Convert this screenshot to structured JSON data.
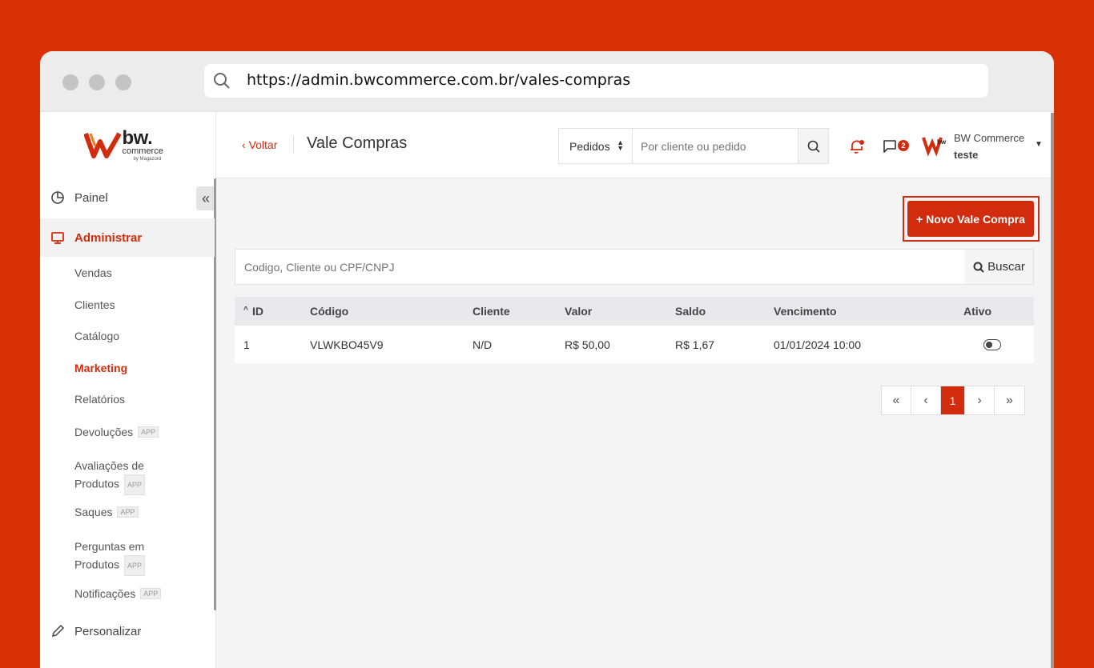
{
  "browser": {
    "url": "https://admin.bwcommerce.com.br/vales-compras"
  },
  "brand": {
    "name": "bw.",
    "sub": "commerce",
    "by": "by Magazord"
  },
  "sidebar": {
    "items": [
      {
        "label": "Painel"
      },
      {
        "label": "Administrar"
      },
      {
        "label": "Vendas"
      },
      {
        "label": "Clientes"
      },
      {
        "label": "Catálogo"
      },
      {
        "label": "Marketing"
      },
      {
        "label": "Relatórios"
      },
      {
        "label": "Devoluções",
        "badge": "APP"
      },
      {
        "label": "Avaliações de",
        "label2": "Produtos",
        "badge": "APP"
      },
      {
        "label": "Saques",
        "badge": "APP"
      },
      {
        "label": "Perguntas em",
        "label2": "Produtos",
        "badge": "APP"
      },
      {
        "label": "Notificações",
        "badge": "APP"
      },
      {
        "label": "Personalizar"
      }
    ]
  },
  "header": {
    "back_label": "Voltar",
    "title": "Vale Compras",
    "search_select": "Pedidos",
    "search_placeholder": "Por cliente ou pedido",
    "chat_count": "2",
    "user_name": "BW Commerce",
    "user_sub": "teste"
  },
  "actions": {
    "new_button": "+ Novo Vale Compra"
  },
  "filter": {
    "placeholder": "Codigo, Cliente ou CPF/CNPJ",
    "button": "Buscar"
  },
  "table": {
    "sort_arrow": "^",
    "columns": [
      "ID",
      "Código",
      "Cliente",
      "Valor",
      "Saldo",
      "Vencimento",
      "Ativo"
    ],
    "rows": [
      {
        "id": "1",
        "codigo": "VLWKBO45V9",
        "cliente": "N/D",
        "valor": "R$ 50,00",
        "saldo": "R$ 1,67",
        "vencimento": "01/01/2024 10:00",
        "ativo": false
      }
    ]
  },
  "pagination": {
    "first": "«",
    "prev": "‹",
    "current": "1",
    "next": "›",
    "last": "»"
  },
  "colors": {
    "accent": "#d12c0d",
    "background": "#d93005"
  }
}
